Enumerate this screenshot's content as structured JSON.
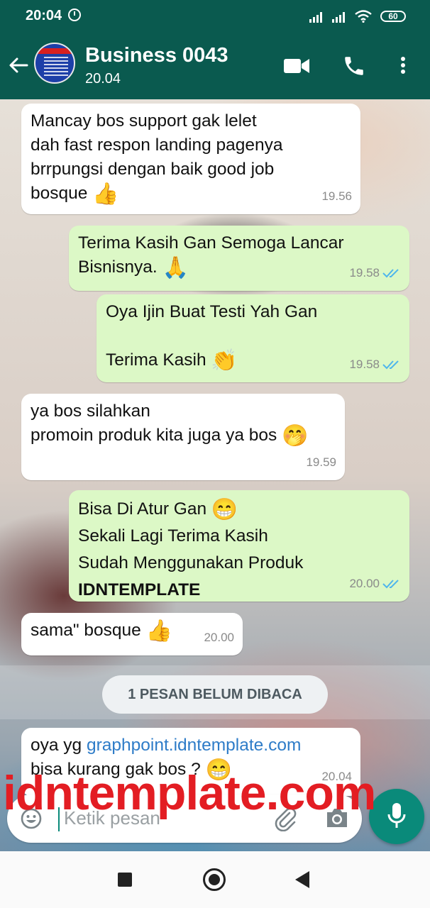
{
  "status_bar": {
    "time": "20:04",
    "battery": "60"
  },
  "header": {
    "title": "Business 0043",
    "subtitle": "20.04"
  },
  "messages": [
    {
      "lines": [
        "Mancay bos support gak lelet",
        "dah fast respon landing pagenya",
        "brrpungsi dengan baik good job",
        "bosque"
      ],
      "emoji": "👍",
      "time": "19.56"
    },
    {
      "lines": [
        "Terima Kasih Gan Semoga Lancar",
        "Bisnisnya."
      ],
      "emoji": "🙏",
      "time": "19.58"
    },
    {
      "lines": [
        "Oya Ijin Buat Testi Yah Gan",
        "",
        "Terima Kasih"
      ],
      "emoji": "👏",
      "time": "19.58"
    },
    {
      "lines": [
        "ya bos silahkan",
        "promoin produk kita juga ya bos"
      ],
      "emoji": "🤭",
      "time": "19.59"
    },
    {
      "lines": [
        "Bisa Di Atur Gan",
        "Sekali Lagi Terima Kasih",
        "Sudah Menggunakan Produk",
        "IDNTEMPLATE"
      ],
      "emoji": "😁",
      "time": "20.00"
    },
    {
      "lines": [
        "sama\" bosque"
      ],
      "emoji": "👍",
      "time": "20.00"
    },
    {
      "prefix": "oya yg ",
      "link": "graphpoint.idntemplate.com",
      "line2": "bisa kurang gak bos ?",
      "emoji": "😁",
      "time": "20.04"
    }
  ],
  "unread_label": "1 PESAN BELUM DIBACA",
  "watermark": "idntemplate.com",
  "composer": {
    "placeholder": "Ketik pesan"
  },
  "icons": [
    "back-arrow-icon",
    "video-call-icon",
    "phone-icon",
    "more-vert-icon",
    "emoji-icon",
    "attach-icon",
    "camera-icon",
    "mic-icon",
    "double-check-icon"
  ],
  "colors": {
    "header": "#0a5a4f",
    "outgoing": "#dcf8c6",
    "incoming": "#ffffff",
    "accent": "#0a8a7a",
    "read_ticks": "#4fb6ec",
    "watermark": "#e31d23"
  }
}
